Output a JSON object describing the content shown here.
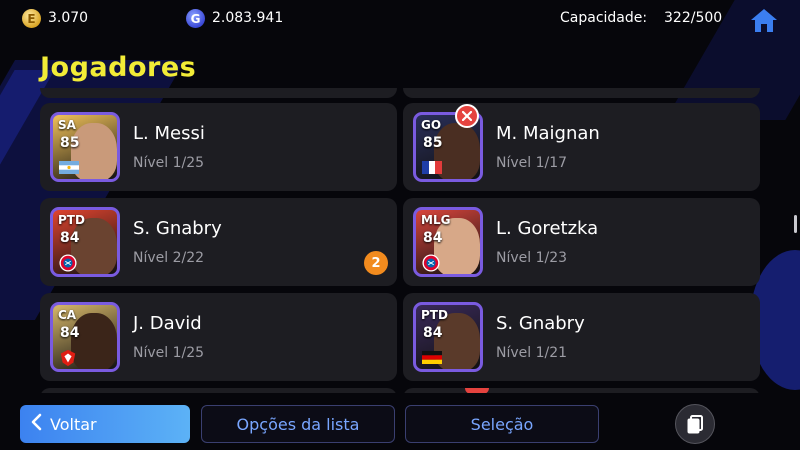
{
  "header": {
    "coins_e": "3.070",
    "coins_g": "2.083.941",
    "capacity_label": "Capacidade:",
    "capacity_value": "322/500",
    "coin_e_glyph": "E",
    "coin_g_glyph": "G"
  },
  "title": "Jogadores",
  "players": [
    {
      "pos": "SA",
      "ovr": "85",
      "name": "L. Messi",
      "level": "Nível 1/25",
      "flag": "argentina",
      "skin": "#c99a7a",
      "bg": "#f2c25a",
      "frame": "#7a5be0"
    },
    {
      "pos": "GO",
      "ovr": "85",
      "name": "M. Maignan",
      "level": "Nível 1/17",
      "flag": "france",
      "skin": "#4a2e22",
      "bg": "#2a2f5a",
      "frame": "#7a5be0",
      "removable": true
    },
    {
      "pos": "PTD",
      "ovr": "84",
      "name": "S. Gnabry",
      "level": "Nível 2/22",
      "flag": "bayern",
      "skin": "#6a4330",
      "bg": "#e0442f",
      "frame": "#7a5be0",
      "badge": "2"
    },
    {
      "pos": "MLG",
      "ovr": "84",
      "name": "L. Goretzka",
      "level": "Nível 1/23",
      "flag": "bayern",
      "skin": "#d7a888",
      "bg": "#d9453c",
      "frame": "#7a5be0"
    },
    {
      "pos": "CA",
      "ovr": "84",
      "name": "J. David",
      "level": "Nível 1/25",
      "flag": "lille",
      "skin": "#3b2519",
      "bg": "#d8b86a",
      "frame": "#7a5be0"
    },
    {
      "pos": "PTD",
      "ovr": "84",
      "name": "S. Gnabry",
      "level": "Nível 1/21",
      "flag": "germany",
      "skin": "#5a3a2a",
      "bg": "#3a2a5a",
      "frame": "#7a5be0"
    }
  ],
  "buttons": {
    "back": "Voltar",
    "list_options": "Opções da lista",
    "selection": "Seleção"
  },
  "colors": {
    "title": "#f2ec37",
    "accent_blue": "#3c82f0",
    "badge_orange": "#f28b1e",
    "remove_red": "#e5433f"
  },
  "icons": {
    "home": "home-icon",
    "back": "chevron-left-icon",
    "copy": "copy-icon"
  }
}
